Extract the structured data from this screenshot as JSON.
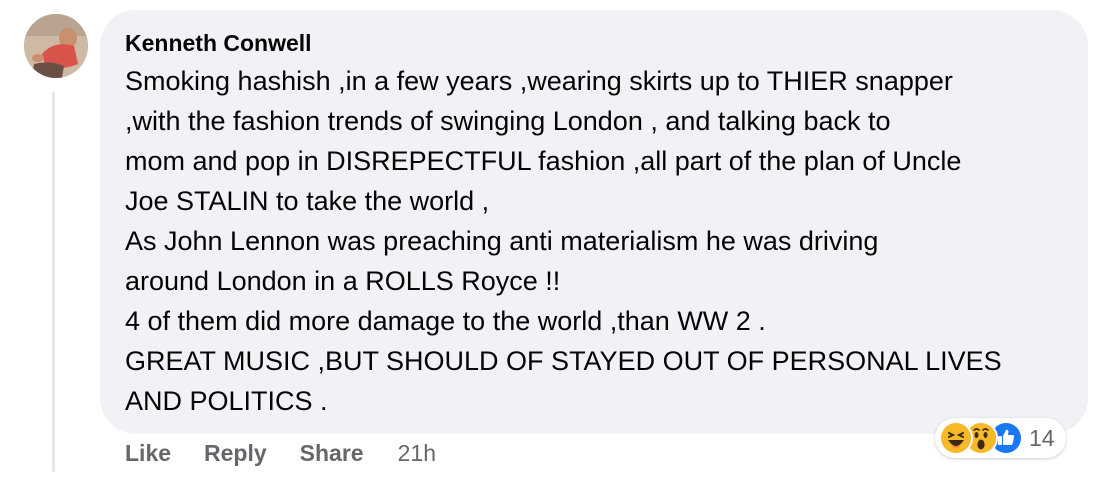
{
  "comment": {
    "author": "Kenneth Conwell",
    "lines": [
      "Smoking hashish ,in a few years ,wearing skirts up to THIER snapper",
      ",with the fashion trends of swinging London , and talking back to",
      "mom and pop in DISREPECTFUL fashion ,all part of the plan of Uncle",
      "Joe STALIN to take the world ,",
      "As John Lennon was preaching anti materialism he was driving",
      "around London in a ROLLS Royce !!",
      "4 of them did more damage to the world ,than WW 2 .",
      "GREAT MUSIC ,BUT SHOULD OF STAYED OUT OF PERSONAL LIVES",
      "AND POLITICS ."
    ]
  },
  "actions": {
    "like": "Like",
    "reply": "Reply",
    "share": "Share",
    "timestamp": "21h"
  },
  "reactions": {
    "icons": [
      "haha-icon",
      "wow-icon",
      "like-icon"
    ],
    "count": "14"
  },
  "colors": {
    "bubble_background": "#f0f2f5",
    "action_text": "#65676b",
    "like_blue": "#1877f2",
    "reaction_yellow": "#f7b928"
  }
}
